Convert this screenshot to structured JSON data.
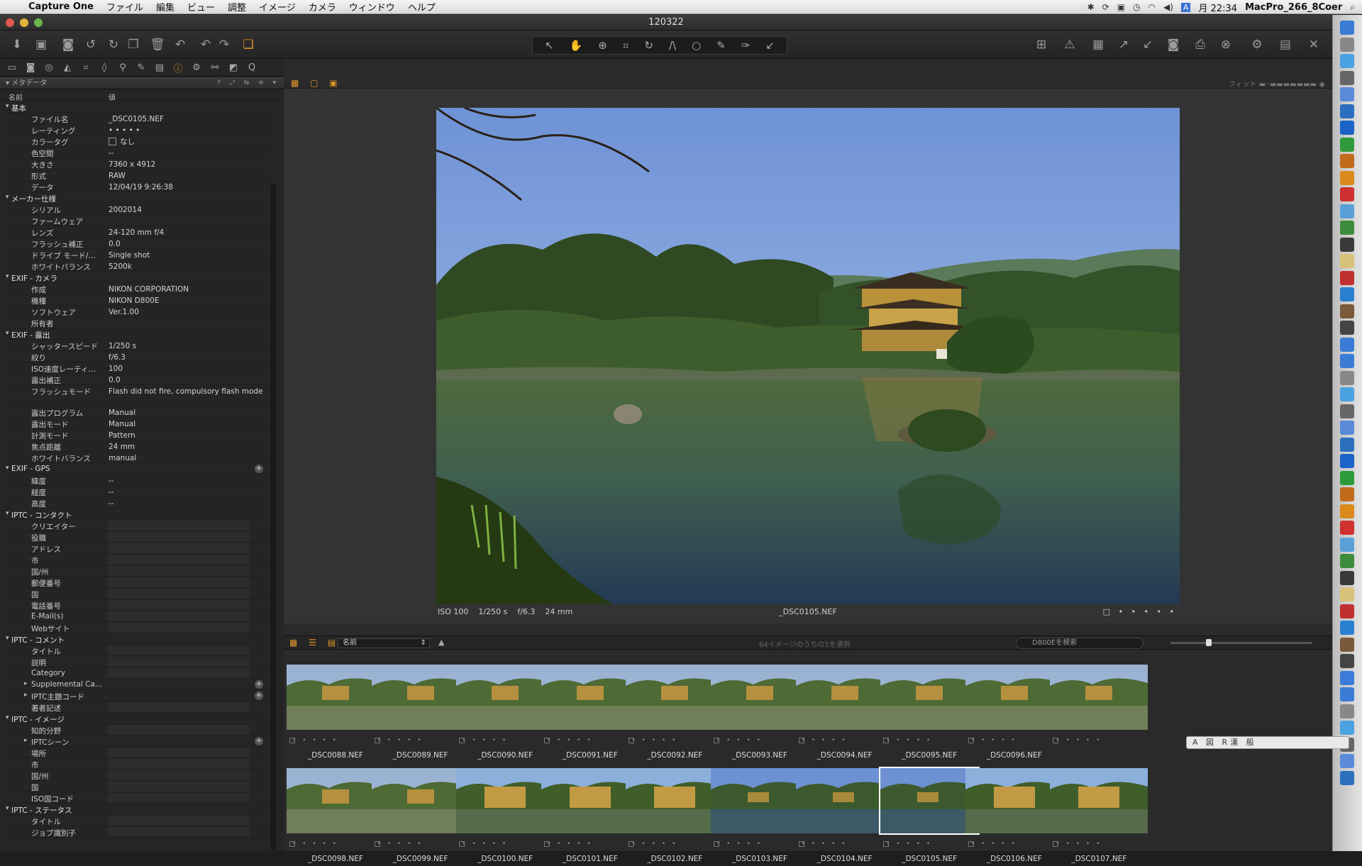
{
  "menubar": {
    "app": "Capture One",
    "items": [
      "ファイル",
      "編集",
      "ビュー",
      "調整",
      "イメージ",
      "カメラ",
      "ウィンドウ",
      "ヘルプ"
    ],
    "clock": "月 22:34",
    "machine": "MacPro_266_8Coer",
    "input_indicator": "A"
  },
  "window": {
    "title": "120322"
  },
  "panel": {
    "title": "メタデータ",
    "col_name": "名前",
    "col_value": "値"
  },
  "metadata": [
    {
      "type": "section",
      "label": "基本"
    },
    {
      "label": "ファイル名",
      "value": "_DSC0105.NEF"
    },
    {
      "label": "レーティング",
      "value": "• • • • •"
    },
    {
      "label": "カラータグ",
      "value": "なし",
      "checkbox": true
    },
    {
      "label": "色空間",
      "value": "--"
    },
    {
      "label": "大きさ",
      "value": "7360 x 4912"
    },
    {
      "label": "形式",
      "value": "RAW"
    },
    {
      "label": "データ",
      "value": "12/04/19 9:26:38"
    },
    {
      "type": "section",
      "label": "メーカー仕様"
    },
    {
      "label": "シリアル",
      "value": "2002014"
    },
    {
      "label": "ファームウェア",
      "value": ""
    },
    {
      "label": "レンズ",
      "value": "24-120 mm f/4"
    },
    {
      "label": "フラッシュ補正",
      "value": "0.0"
    },
    {
      "label": "ドライブ モード/…",
      "value": "Single shot"
    },
    {
      "label": "ホワイトバランス",
      "value": "5200k"
    },
    {
      "type": "section",
      "label": "EXIF - カメラ"
    },
    {
      "label": "作成",
      "value": "NIKON CORPORATION"
    },
    {
      "label": "機種",
      "value": "NIKON D800E"
    },
    {
      "label": "ソフトウェア",
      "value": "Ver.1.00"
    },
    {
      "label": "所有者",
      "value": ""
    },
    {
      "type": "section",
      "label": "EXIF - 露出"
    },
    {
      "label": "シャッタースピード",
      "value": "1/250 s"
    },
    {
      "label": "絞り",
      "value": "f/6.3"
    },
    {
      "label": "ISO速度レーティ…",
      "value": "100"
    },
    {
      "label": "露出補正",
      "value": "0.0"
    },
    {
      "label": "フラッシュモード",
      "value": "Flash did not fire, compulsory flash mode",
      "tall": true
    },
    {
      "label": "露出プログラム",
      "value": "Manual"
    },
    {
      "label": "露出モード",
      "value": "Manual"
    },
    {
      "label": "計測モード",
      "value": "Pattern"
    },
    {
      "label": "焦点距離",
      "value": "24 mm"
    },
    {
      "label": "ホワイトバランス",
      "value": "manual"
    },
    {
      "type": "section",
      "label": "EXIF - GPS",
      "plus": true
    },
    {
      "label": "緯度",
      "value": "--"
    },
    {
      "label": "経度",
      "value": "--"
    },
    {
      "label": "高度",
      "value": "--"
    },
    {
      "type": "section",
      "label": "IPTC - コンタクト"
    },
    {
      "label": "クリエイター",
      "value": "",
      "field": true
    },
    {
      "label": "役職",
      "value": "",
      "field": true
    },
    {
      "label": "アドレス",
      "value": "",
      "field": true
    },
    {
      "label": "市",
      "value": "",
      "field": true
    },
    {
      "label": "国/州",
      "value": "",
      "field": true
    },
    {
      "label": "郵便番号",
      "value": "",
      "field": true
    },
    {
      "label": "国",
      "value": "",
      "field": true
    },
    {
      "label": "電話番号",
      "value": "",
      "field": true
    },
    {
      "label": "E-Mail(s)",
      "value": "",
      "field": true
    },
    {
      "label": "Webサイト",
      "value": "",
      "field": true
    },
    {
      "type": "section",
      "label": "IPTC - コメント"
    },
    {
      "label": "タイトル",
      "value": "",
      "field": true
    },
    {
      "label": "説明",
      "value": "",
      "field": true
    },
    {
      "label": "Category",
      "value": "",
      "field": true
    },
    {
      "type": "sub",
      "label": "Supplemental Ca...",
      "plus": true
    },
    {
      "type": "sub",
      "label": "IPTC主題コード",
      "plus": true
    },
    {
      "label": "著者記述",
      "value": "",
      "field": true
    },
    {
      "type": "section",
      "label": "IPTC - イメージ"
    },
    {
      "label": "知的分野",
      "value": "",
      "field": true
    },
    {
      "type": "sub",
      "label": "IPTCシーン",
      "plus": true
    },
    {
      "label": "場所",
      "value": "",
      "field": true
    },
    {
      "label": "市",
      "value": "",
      "field": true
    },
    {
      "label": "国/州",
      "value": "",
      "field": true
    },
    {
      "label": "国",
      "value": "",
      "field": true
    },
    {
      "label": "ISO国コード",
      "value": "",
      "field": true
    },
    {
      "type": "section",
      "label": "IPTC - ステータス"
    },
    {
      "label": "タイトル",
      "value": "",
      "field": true
    },
    {
      "label": "ジョブ識別子",
      "value": "",
      "field": true
    }
  ],
  "viewer": {
    "fit_label": "フィット",
    "iso": "ISO 100",
    "shutter": "1/250 s",
    "aperture": "f/6.3",
    "focal": "24 mm",
    "filename": "_DSC0105.NEF",
    "rating": "• • • • •"
  },
  "browser": {
    "sort": "名前",
    "count_text": "64イメージのうちの1を選択",
    "search_placeholder": "D800Eを検索"
  },
  "thumbnails": [
    {
      "name": "_DSC0088.NEF",
      "kind": "wide"
    },
    {
      "name": "_DSC0089.NEF",
      "kind": "wide"
    },
    {
      "name": "_DSC0090.NEF",
      "kind": "wide"
    },
    {
      "name": "_DSC0091.NEF",
      "kind": "wide"
    },
    {
      "name": "_DSC0092.NEF",
      "kind": "wide"
    },
    {
      "name": "_DSC0093.NEF",
      "kind": "wide"
    },
    {
      "name": "_DSC0094.NEF",
      "kind": "wide"
    },
    {
      "name": "_DSC0095.NEF",
      "kind": "wide"
    },
    {
      "name": "_DSC0096.NEF",
      "kind": "wide"
    },
    {
      "name": "",
      "kind": "wide"
    },
    {
      "name": "_DSC0098.NEF",
      "kind": "wide"
    },
    {
      "name": "_DSC0099.NEF",
      "kind": "wide"
    },
    {
      "name": "_DSC0100.NEF",
      "kind": "close"
    },
    {
      "name": "_DSC0101.NEF",
      "kind": "close"
    },
    {
      "name": "_DSC0102.NEF",
      "kind": "close"
    },
    {
      "name": "_DSC0103.NEF",
      "kind": "pond"
    },
    {
      "name": "_DSC0104.NEF",
      "kind": "pond"
    },
    {
      "name": "_DSC0105.NEF",
      "kind": "pond",
      "selected": true
    },
    {
      "name": "_DSC0106.NEF",
      "kind": "close"
    },
    {
      "name": "_DSC0107.NEF",
      "kind": "close"
    }
  ],
  "ime_bar": "A 図 R漢 般",
  "colors": {
    "accent": "#e0962a",
    "panel_bg": "#252525",
    "window_bg": "#2a2a2a"
  }
}
